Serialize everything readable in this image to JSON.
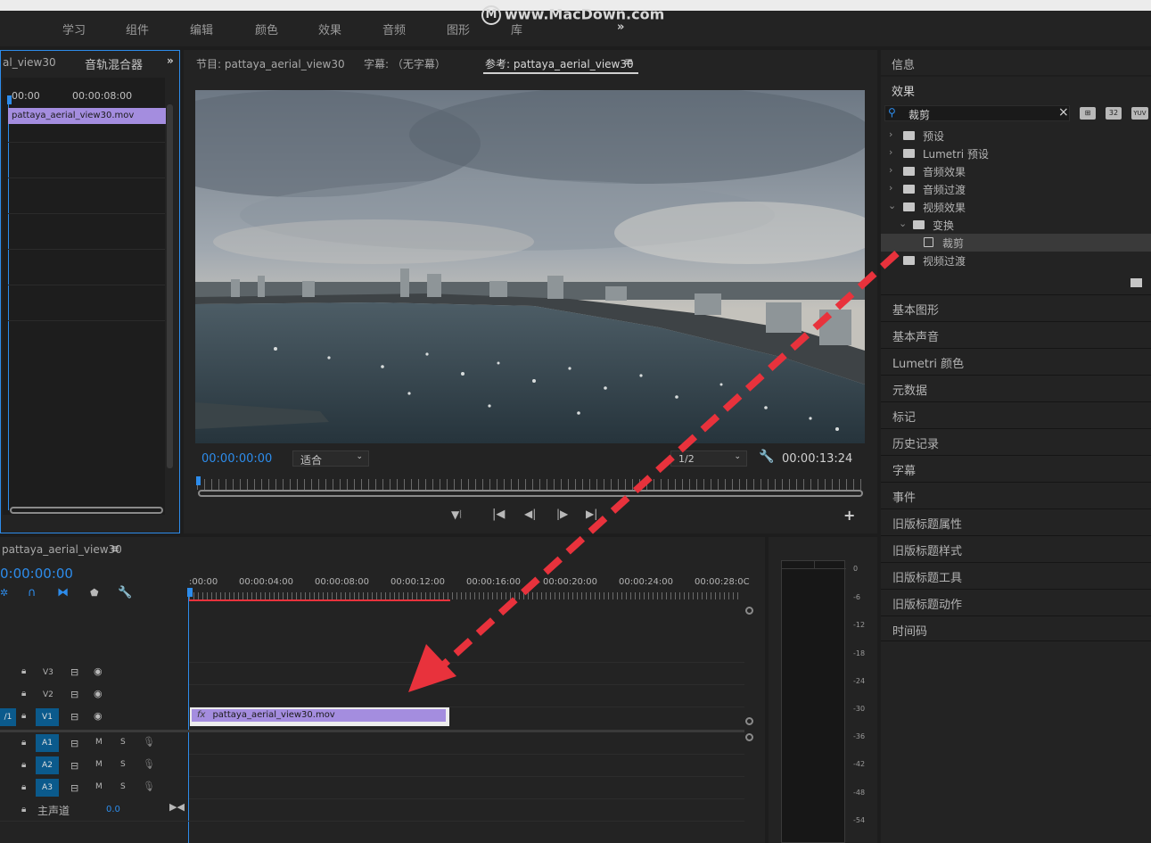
{
  "watermark": "www.MacDown.com",
  "workspaces": [
    "学习",
    "组件",
    "编辑",
    "颜色",
    "效果",
    "音频",
    "图形",
    "库"
  ],
  "workspace_more": "»",
  "left_panel": {
    "tab1": "al_view30",
    "tab2": "音轨混合器",
    "more": "»",
    "tc_start": "00:00",
    "tc_mid": "00:00:08:00",
    "clip_name": "pattaya_aerial_view30.mov"
  },
  "monitor": {
    "tab_program": "节目: pattaya_aerial_view30",
    "tab_captions": "字幕: （无字幕）",
    "tab_reference": "参考: pattaya_aerial_view30",
    "menu_icon": "≡",
    "timecode_current": "00:00:00:00",
    "fit": "适合",
    "resolution": "1/2",
    "timecode_duration": "00:00:13:24"
  },
  "effects_panel": {
    "info_label": "信息",
    "effects_label": "效果",
    "search_value": "裁剪",
    "search_clear": "×",
    "filter_badges": [
      "32",
      "YUV"
    ],
    "tree": [
      {
        "label": "预设"
      },
      {
        "label": "Lumetri 预设"
      },
      {
        "label": "音频效果"
      },
      {
        "label": "音频过渡"
      },
      {
        "label": "视频效果"
      },
      {
        "label": "变换"
      },
      {
        "label": "裁剪"
      },
      {
        "label": "视频过渡"
      }
    ]
  },
  "right_panels": [
    "基本图形",
    "基本声音",
    "Lumetri 颜色",
    "元数据",
    "标记",
    "历史记录",
    "字幕",
    "事件",
    "旧版标题属性",
    "旧版标题样式",
    "旧版标题工具",
    "旧版标题动作",
    "时间码"
  ],
  "timeline": {
    "sequence_name": "pattaya_aerial_view30",
    "menu_icon": "≡",
    "timecode": "0:00:00:00",
    "ruler": [
      ":00:00",
      "00:00:04:00",
      "00:00:08:00",
      "00:00:12:00",
      "00:00:16:00",
      "00:00:20:00",
      "00:00:24:00",
      "00:00:28:0C"
    ],
    "video_tracks": [
      "V3",
      "V2",
      "V1"
    ],
    "audio_tracks": [
      "A1",
      "A2",
      "A3"
    ],
    "source_v": "/1",
    "mute": "M",
    "solo": "S",
    "master_label": "主声道",
    "master_value": "0.0",
    "clip_label": "pattaya_aerial_view30.mov",
    "fx_badge": "fx"
  },
  "audio_meter": {
    "labels": [
      "0",
      "-6",
      "-12",
      "-18",
      "-24",
      "-30",
      "-36",
      "-42",
      "-48",
      "-54"
    ]
  },
  "colors": {
    "accent_blue": "#2d8ceb",
    "clip_purple": "#a48ddf",
    "arrow_red": "#e8323c"
  }
}
